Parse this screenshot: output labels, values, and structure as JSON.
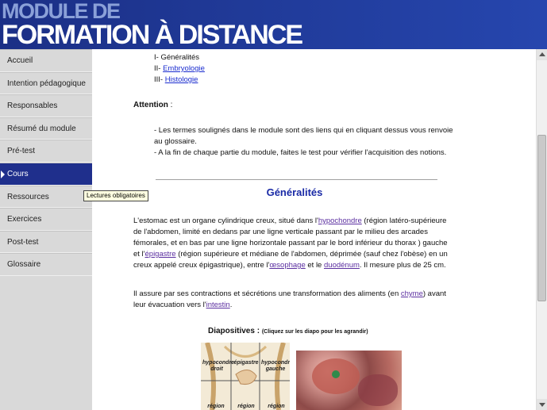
{
  "banner": {
    "line1": "MODULE DE",
    "line2": "FORMATION À DISTANCE"
  },
  "sidebar": {
    "items": [
      {
        "label": "Accueil"
      },
      {
        "label": "Intention pédagogique"
      },
      {
        "label": "Responsables"
      },
      {
        "label": "Résumé du module"
      },
      {
        "label": "Pré-test"
      },
      {
        "label": "Cours"
      },
      {
        "label": "Ressources"
      },
      {
        "label": "Exercices"
      },
      {
        "label": "Post-test"
      },
      {
        "label": "Glossaire"
      }
    ],
    "tooltip": "Lectures obligatoires"
  },
  "content": {
    "toc": [
      {
        "prefix": "I-",
        "label": "Généralités"
      },
      {
        "prefix": "II-",
        "label": "Embryologie"
      },
      {
        "prefix": "III-",
        "label": "Histologie"
      }
    ],
    "attention": {
      "label": "Attention",
      "suffix": " :"
    },
    "notes": {
      "line1a": "- Les termes soulignés dans le module sont des liens qui en cliquant dessus vous renvoie",
      "line1b": "au glossaire.",
      "line2": "- A la fin de chaque partie du module, faites le test pour vérifier l'acquisition des notions."
    },
    "section_title": "Généralités",
    "para1": {
      "t1": "L'estomac est un organe cylindrique creux, situé dans l'",
      "l1": "hypochondre",
      "t2": " (région latéro-supérieure de l'abdomen, limité en dedans par une ligne verticale passant par le milieu des arcades fémorales, et en bas par une ligne horizontale passant par le bord inférieur du thorax ) gauche et l'",
      "l2": "épigastre",
      "t3": " (région supérieure et médiane de l'abdomen, déprimée (sauf chez l'obèse) en un creux appelé creux épigastrique), entre l'",
      "l3": "œsophage",
      "t4": " et le ",
      "l4": "duodénum",
      "t5": ". Il mesure plus de 25 cm."
    },
    "para2": {
      "t1": "Il assure par ses contractions et sécrétions une transformation des aliments (en ",
      "l1": "chyme",
      "t2": ") avant leur évacuation vers l'",
      "l2": "intestin",
      "t3": "."
    },
    "diapo": {
      "title": "Diapositives",
      "colon": " : ",
      "hint": "(Cliquez sur les diapo pour les agrandir)",
      "slide1_labels": {
        "a": "hypocondre droit",
        "b": "épigastre",
        "c": "hypocondre gauche",
        "d": "région",
        "e": "région",
        "f": "région"
      }
    }
  }
}
